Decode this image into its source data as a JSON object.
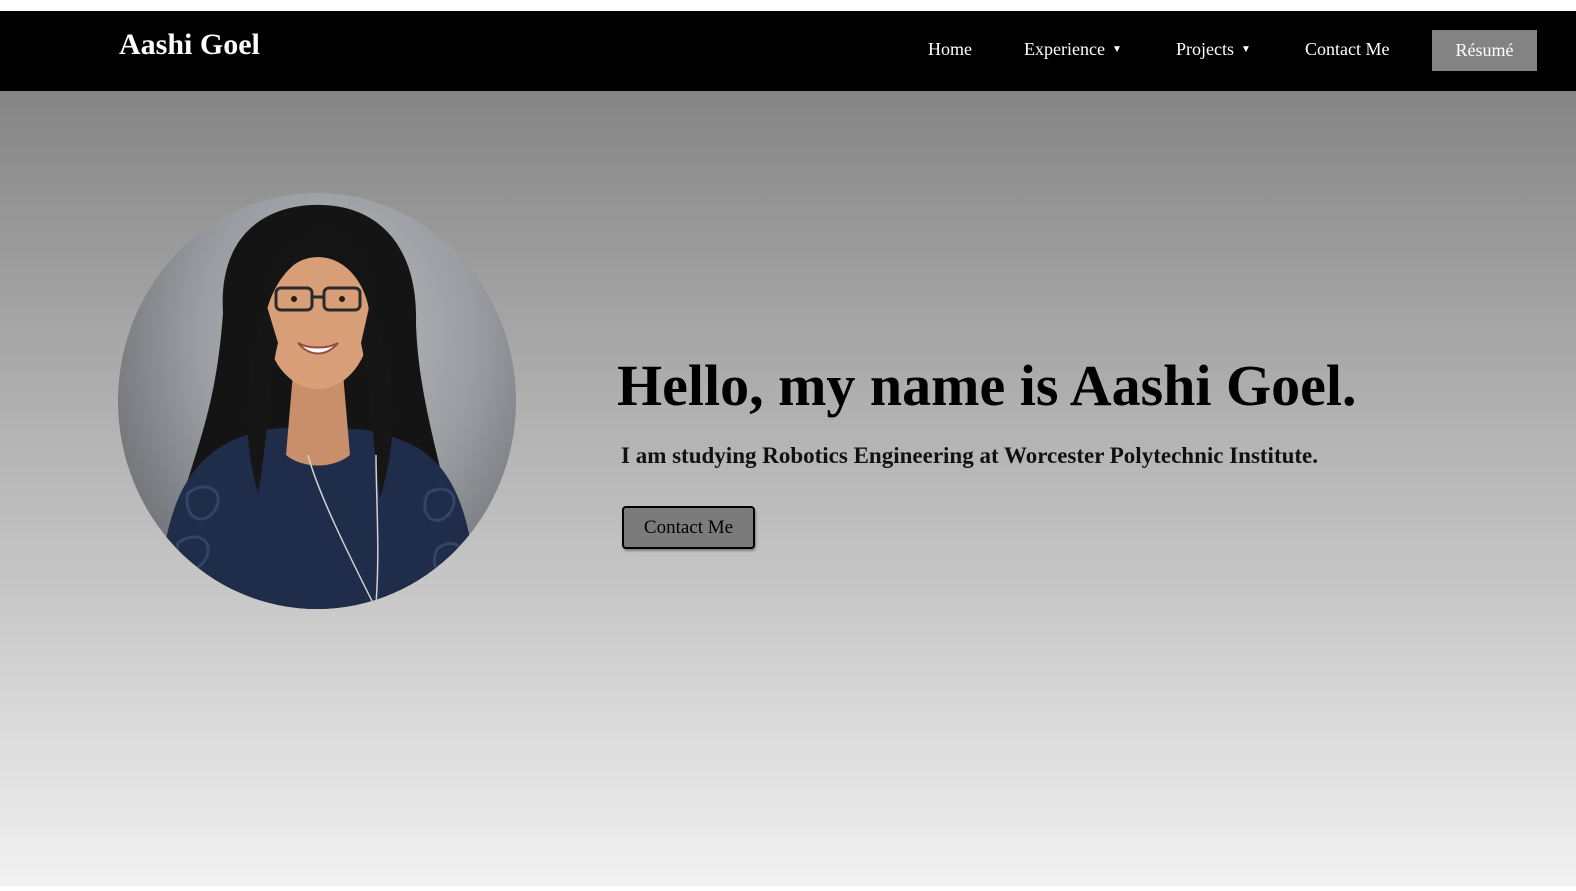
{
  "navbar": {
    "brand": "Aashi Goel",
    "items": [
      {
        "label": "Home"
      },
      {
        "label": "Experience",
        "caret": "▼"
      },
      {
        "label": "Projects",
        "caret": "▼"
      },
      {
        "label": "Contact Me"
      }
    ],
    "resume_label": "Résumé"
  },
  "hero": {
    "headline": "Hello, my name is Aashi Goel.",
    "subline": "I am studying Robotics Engineering at Worcester Polytechnic Institute.",
    "contact_label": "Contact Me",
    "avatar_icon": "profile-photo"
  },
  "colors": {
    "navbar_bg": "#000000",
    "resume_button_bg": "#838383",
    "contact_button_bg": "#7b7b7b",
    "hero_gradient_top": "#858585",
    "hero_gradient_bottom": "#f2f2f2"
  }
}
